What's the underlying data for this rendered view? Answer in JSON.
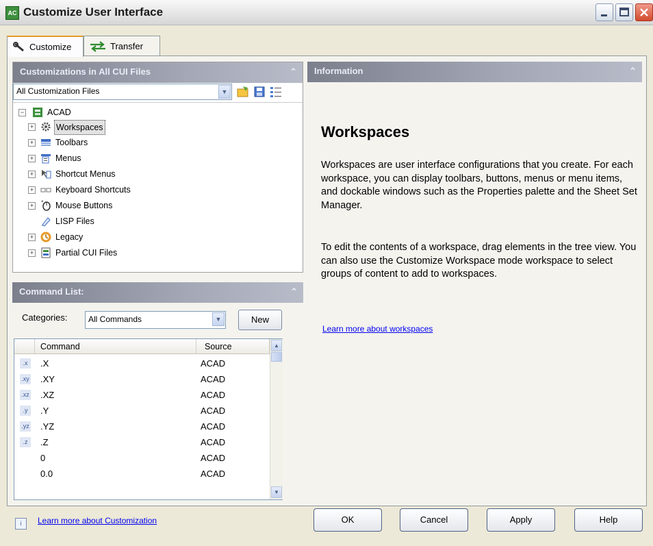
{
  "window": {
    "title": "Customize User Interface",
    "app_icon_text": "AC"
  },
  "tabs": [
    {
      "label": "Customize",
      "icon": "wrench-icon",
      "active": true
    },
    {
      "label": "Transfer",
      "icon": "transfer-arrows-icon",
      "active": false
    }
  ],
  "customizations_panel": {
    "header": "Customizations in All CUI Files",
    "file_filter": "All Customization Files",
    "tree": {
      "root": "ACAD",
      "items": [
        {
          "label": "Workspaces",
          "icon": "workspaces-gear-icon",
          "selected": true
        },
        {
          "label": "Toolbars",
          "icon": "toolbars-icon"
        },
        {
          "label": "Menus",
          "icon": "menus-icon"
        },
        {
          "label": "Shortcut Menus",
          "icon": "shortcut-menus-icon"
        },
        {
          "label": "Keyboard Shortcuts",
          "icon": "keyboard-shortcuts-icon"
        },
        {
          "label": "Mouse Buttons",
          "icon": "mouse-buttons-icon"
        },
        {
          "label": "LISP Files",
          "icon": "lisp-files-icon"
        },
        {
          "label": "Legacy",
          "icon": "legacy-icon"
        },
        {
          "label": "Partial CUI Files",
          "icon": "partial-cui-files-icon"
        }
      ]
    }
  },
  "command_list": {
    "header": "Command List:",
    "categories_label": "Categories:",
    "categories_value": "All Commands",
    "new_button": "New",
    "columns": [
      "Command",
      "Source"
    ],
    "rows": [
      {
        "icon": ".x",
        "command": ".X",
        "source": "ACAD"
      },
      {
        "icon": ".xy",
        "command": ".XY",
        "source": "ACAD"
      },
      {
        "icon": ".xz",
        "command": ".XZ",
        "source": "ACAD"
      },
      {
        "icon": ".y",
        "command": ".Y",
        "source": "ACAD"
      },
      {
        "icon": ".yz",
        "command": ".YZ",
        "source": "ACAD"
      },
      {
        "icon": ".z",
        "command": ".Z",
        "source": "ACAD"
      },
      {
        "icon": "",
        "command": "0",
        "source": "ACAD"
      },
      {
        "icon": "",
        "command": "0.0",
        "source": "ACAD"
      }
    ]
  },
  "information_panel": {
    "header": "Information",
    "title": "Workspaces",
    "paragraph1": "Workspaces are user interface configurations that you create. For each workspace, you can display toolbars, buttons, menus or menu items, and dockable windows such as the Properties palette and the Sheet Set Manager.",
    "paragraph2": "To edit the contents of a workspace, drag elements in the tree view. You can also use the Customize Workspace mode workspace to select groups of content to add to workspaces.",
    "link": "Learn more about workspaces"
  },
  "footer": {
    "link": "Learn more about Customization",
    "buttons": {
      "ok": "OK",
      "cancel": "Cancel",
      "apply": "Apply",
      "help": "Help"
    }
  }
}
